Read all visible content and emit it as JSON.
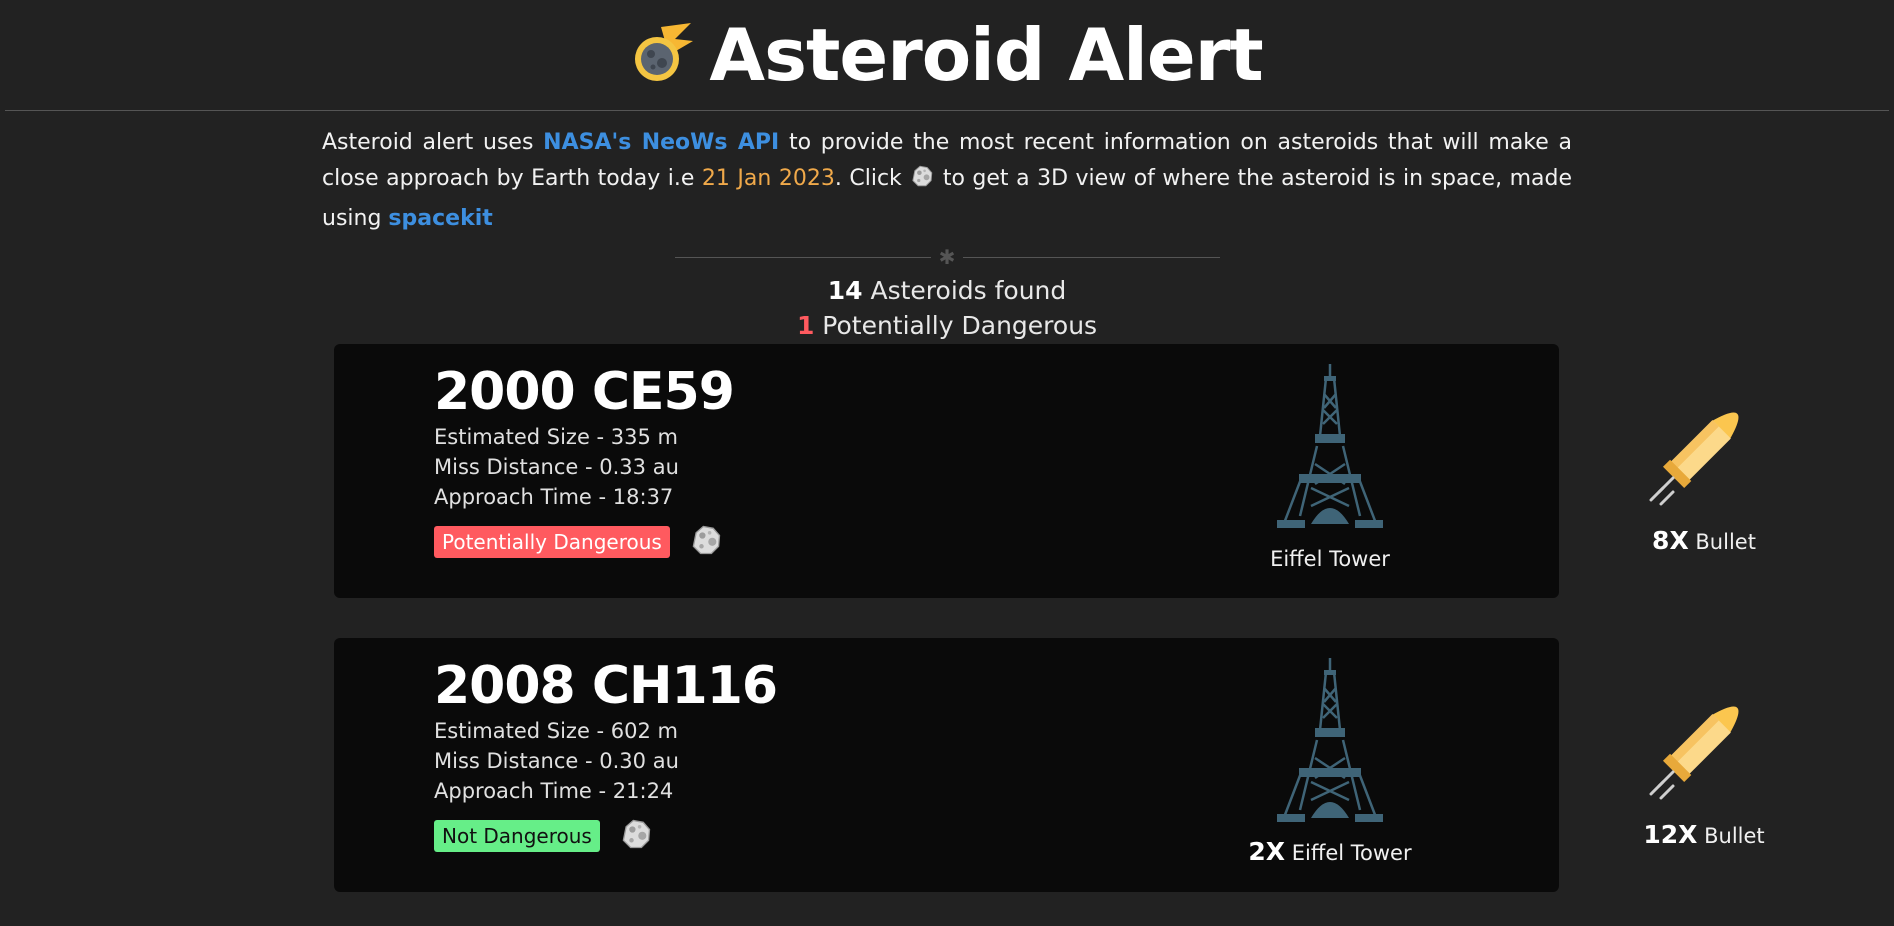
{
  "header": {
    "title": "Asteroid Alert",
    "logo_icon": "meteor-icon"
  },
  "intro": {
    "text1": "Asteroid alert uses ",
    "api_link": "NASA's NeoWs API",
    "text2": " to provide the most recent information on asteroids that will make a close approach by Earth today i.e ",
    "date": "21 Jan 2023",
    "text3": ". Click ",
    "text4": " to get a 3D view of where the asteroid is in space, made using ",
    "spacekit_link": "spacekit"
  },
  "summary": {
    "count": "14",
    "count_label": " Asteroids found",
    "danger_count": "1",
    "danger_label": " Potentially Dangerous"
  },
  "asteroids": [
    {
      "name": "2000 CE59",
      "size": "Estimated Size - 335 m",
      "miss": "Miss Distance - 0.33 au",
      "time": "Approach Time - 18:37",
      "status": "Potentially Dangerous",
      "tower_mult": "",
      "tower_label": "Eiffel Tower",
      "bullet_mult": "8X",
      "bullet_label": " Bullet"
    },
    {
      "name": "2008 CH116",
      "size": "Estimated Size - 602 m",
      "miss": "Miss Distance - 0.30 au",
      "time": "Approach Time - 21:24",
      "status": "Not Dangerous",
      "tower_mult": "2X",
      "tower_label": " Eiffel Tower",
      "bullet_mult": "12X",
      "bullet_label": " Bullet"
    }
  ],
  "colors": {
    "background": "#222222",
    "card": "#0a0a0a",
    "link": "#3d8fe0",
    "date": "#f0a94a",
    "danger": "#ff5a5f",
    "safe": "#66ee88"
  }
}
